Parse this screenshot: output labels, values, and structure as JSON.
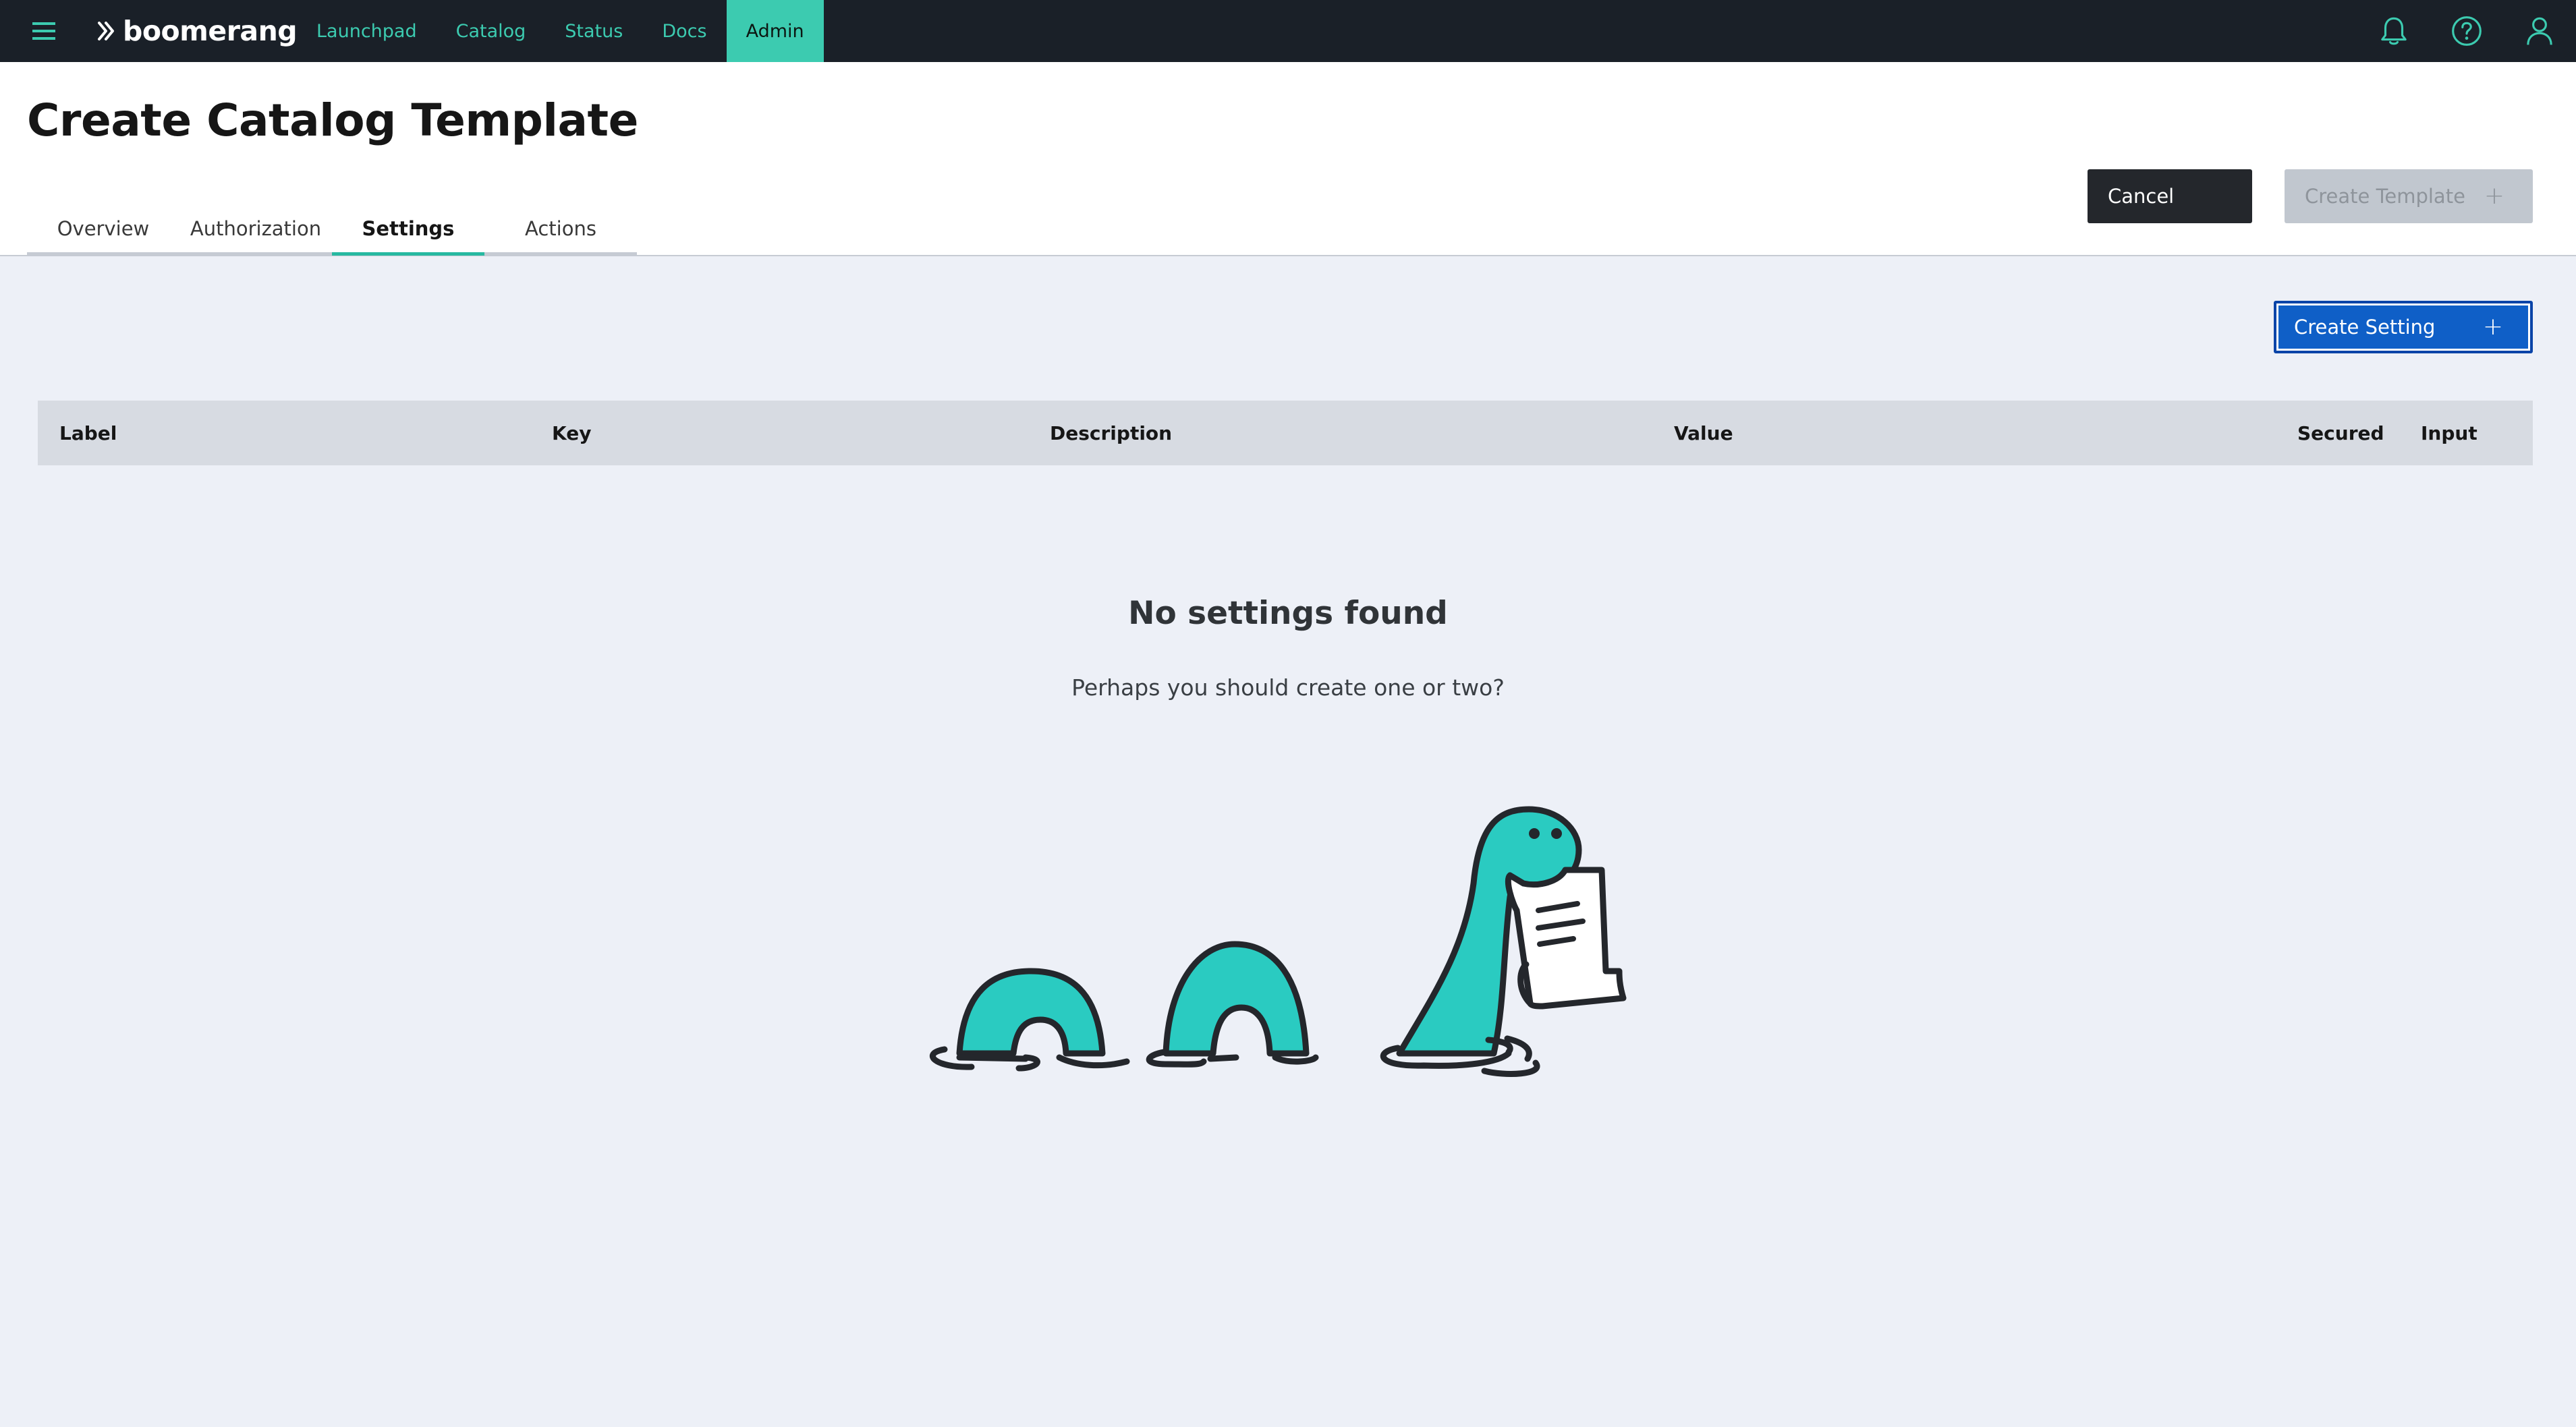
{
  "app": {
    "brand": "boomerang",
    "nav": [
      "Launchpad",
      "Catalog",
      "Status",
      "Docs",
      "Admin"
    ],
    "active_nav": "Admin",
    "icons": [
      "menu-icon",
      "bell-icon",
      "help-icon",
      "user-icon"
    ]
  },
  "page": {
    "title": "Create Catalog Template",
    "tabs": [
      "Overview",
      "Authorization",
      "Settings",
      "Actions"
    ],
    "active_tab": "Settings"
  },
  "actions": {
    "cancel": "Cancel",
    "create_template": "Create Template",
    "create_setting": "Create Setting"
  },
  "table": {
    "columns": [
      "Label",
      "Key",
      "Description",
      "Value",
      "Secured",
      "Input"
    ],
    "rows": []
  },
  "empty_state": {
    "title": "No settings found",
    "subtitle": "Perhaps you should create one or two?"
  },
  "colors": {
    "topbar": "#1a2028",
    "accent": "#3ccbb0",
    "primary_button": "#0f5fc7",
    "page_background": "#edf0f7",
    "illustration": "#2acbc1"
  }
}
